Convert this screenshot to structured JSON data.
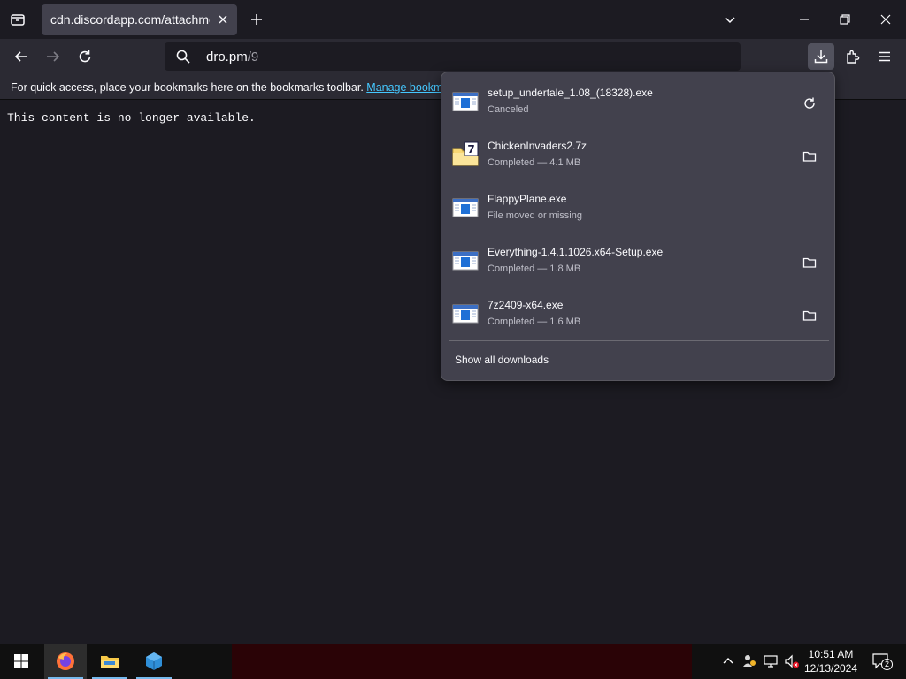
{
  "tab": {
    "title": "cdn.discordapp.com/attachments/"
  },
  "urlbar": {
    "host": "dro.pm",
    "path": "/9"
  },
  "bookmarks": {
    "message": "For quick access, place your bookmarks here on the bookmarks toolbar. ",
    "link": "Manage bookmarks"
  },
  "page": {
    "text": "This content is no longer available."
  },
  "downloads": {
    "items": [
      {
        "name": "setup_undertale_1.08_(18328).exe",
        "status": "Canceled",
        "action": "retry-icon",
        "icon": "exe-file-icon"
      },
      {
        "name": "ChickenInvaders2.7z",
        "status": "Completed — 4.1 MB",
        "action": "folder-icon",
        "icon": "7z-archive-icon"
      },
      {
        "name": "FlappyPlane.exe",
        "status": "File moved or missing",
        "action": "",
        "icon": "exe-file-icon"
      },
      {
        "name": "Everything-1.4.1.1026.x64-Setup.exe",
        "status": "Completed — 1.8 MB",
        "action": "folder-icon",
        "icon": "exe-file-icon"
      },
      {
        "name": "7z2409-x64.exe",
        "status": "Completed — 1.6 MB",
        "action": "folder-icon",
        "icon": "exe-file-icon"
      }
    ],
    "show_all": "Show all downloads"
  },
  "taskbar": {
    "time": "10:51 AM",
    "date": "12/13/2024",
    "notification_count": "2"
  },
  "colors": {
    "accent": "#45c8ff",
    "panel": "#42414d",
    "toolbar": "#2b2a33",
    "background": "#1c1b22"
  }
}
